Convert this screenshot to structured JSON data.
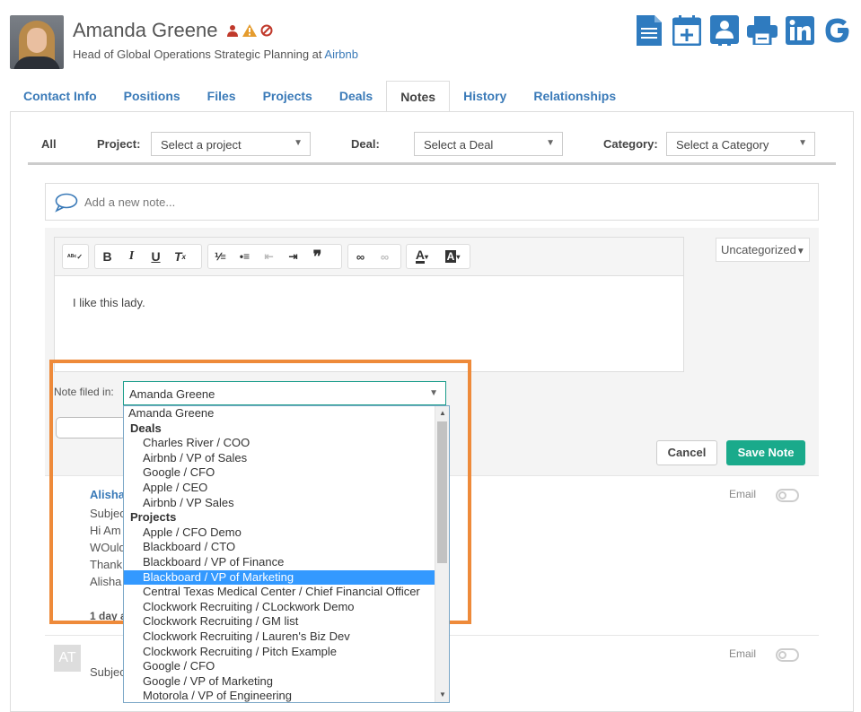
{
  "contact": {
    "name": "Amanda Greene",
    "title_prefix": "Head of Global Operations Strategic Planning at ",
    "company": "Airbnb"
  },
  "header_icons": [
    "person-icon",
    "warning-icon",
    "ban-icon"
  ],
  "actions": [
    "document-icon",
    "calendar-add-icon",
    "contact-card-icon",
    "print-icon",
    "linkedin-icon",
    "google-icon"
  ],
  "colors": {
    "link": "#3a7ab8",
    "accent": "#1aaa8b",
    "highlight": "#ee8a3a",
    "selected": "#3399ff"
  },
  "tabs": [
    {
      "label": "Contact Info"
    },
    {
      "label": "Positions"
    },
    {
      "label": "Files"
    },
    {
      "label": "Projects"
    },
    {
      "label": "Deals"
    },
    {
      "label": "Notes",
      "active": true
    },
    {
      "label": "History"
    },
    {
      "label": "Relationships"
    }
  ],
  "filters": {
    "all": "All",
    "project_label": "Project:",
    "project_value": "Select a project",
    "deal_label": "Deal:",
    "deal_value": "Select a Deal",
    "category_label": "Category:",
    "category_value": "Select a Category"
  },
  "add_note_placeholder": "Add a new note...",
  "editor": {
    "body": "I like this lady.",
    "category": "Uncategorized",
    "filed_label": "Note filed in:",
    "filed_value": "Amanda Greene",
    "cancel": "Cancel",
    "save": "Save Note"
  },
  "dropdown": {
    "top": "Amanda Greene",
    "groups": [
      {
        "label": "Deals",
        "items": [
          "Charles River / COO",
          "Airbnb / VP of Sales",
          "Google / CFO",
          "Apple / CEO",
          "Airbnb / VP Sales"
        ]
      },
      {
        "label": "Projects",
        "items": [
          "Apple / CFO Demo",
          "Blackboard / CTO",
          "Blackboard / VP of Finance",
          "Blackboard / VP of Marketing",
          "Central Texas Medical Center / Chief Financial Officer",
          "Clockwork Recruiting / CLockwork Demo",
          "Clockwork Recruiting / GM list",
          "Clockwork Recruiting / Lauren's Biz Dev",
          "Clockwork Recruiting / Pitch Example",
          "Google / CFO",
          "Google / VP of Marketing",
          "Motorola / VP of Engineering"
        ]
      }
    ],
    "selected": "Blackboard / VP of Marketing"
  },
  "notes": [
    {
      "author": "Alisha",
      "lines": [
        "Subjec",
        "Hi Am",
        "WOuld",
        "Thank",
        "Alisha"
      ],
      "time": "1 day a",
      "email_label": "Email"
    },
    {
      "avatar": "AT",
      "lines": [
        "Subjec"
      ],
      "email_label": "Email"
    }
  ]
}
